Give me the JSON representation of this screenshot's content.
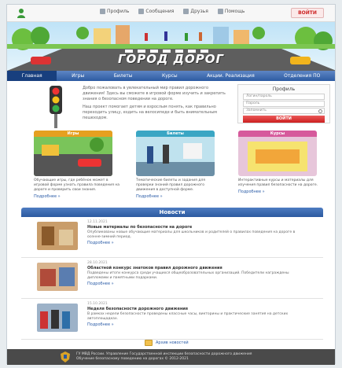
{
  "header": {
    "links": [
      {
        "label": "Профиль",
        "icon": "profile-icon"
      },
      {
        "label": "Сообщения",
        "icon": "messages-icon"
      },
      {
        "label": "Друзья",
        "icon": "friends-icon"
      },
      {
        "label": "Помощь",
        "icon": "help-icon"
      }
    ],
    "cta_label": "ВОЙТИ"
  },
  "banner": {
    "title": "ГОРОД ДОРОГ"
  },
  "nav": {
    "items": [
      {
        "label": "Главная"
      },
      {
        "label": "Игры"
      },
      {
        "label": "Билеты"
      },
      {
        "label": "Курсы"
      },
      {
        "label": "Акции. Реализация"
      },
      {
        "label": "Отделения ПО"
      }
    ]
  },
  "intro": {
    "paragraphs": [
      "Добро пожаловать в увлекательный мир правил дорожного движения! Здесь вы сможете в игровой форме изучить и закрепить знания о безопасном поведении на дороге.",
      "Наш проект помогает детям и взрослым понять, как правильно переходить улицу, ездить на велосипеде и быть внимательным пешеходом."
    ]
  },
  "login": {
    "title": "Профиль",
    "login_placeholder": "Логин/пароль",
    "pass_placeholder": "Пароль",
    "remember_label": "Запомнить",
    "submit_label": "ВОЙТИ"
  },
  "cards": [
    {
      "tab": "Игры",
      "text": "Обучающие игры, где ребёнок может в игровой форме узнать правила поведения на дороге и проверить свои знания.",
      "more": "Подробнее »",
      "color": "#e6a020"
    },
    {
      "tab": "Билеты",
      "text": "Тематические билеты и задания для проверки знаний правил дорожного движения в доступной форме.",
      "more": "Подробнее »",
      "color": "#3aa6c4"
    },
    {
      "tab": "Курсы",
      "text": "Интерактивные курсы и материалы для изучения правил безопасности на дороге.",
      "more": "Подробнее »",
      "color": "#d65a9c"
    }
  ],
  "news": {
    "header": "Новости",
    "items": [
      {
        "date": "12.11.2021",
        "title": "Новые материалы по безопасности на дороге",
        "text": "Опубликованы новые обучающие материалы для школьников и родителей о правилах поведения на дороге в осенне-зимний период.",
        "more": "Подробнее »"
      },
      {
        "date": "28.10.2021",
        "title": "Областной конкурс знатоков правил дорожного движения",
        "text": "Подведены итоги конкурса среди учащихся общеобразовательных организаций. Победители награждены дипломами и памятными подарками.",
        "more": "Подробнее »"
      },
      {
        "date": "15.10.2021",
        "title": "Неделя безопасности дорожного движения",
        "text": "В рамках недели безопасности проведены классные часы, викторины и практические занятия на детских автоплощадках.",
        "more": "Подробнее »"
      }
    ],
    "all_label": "Архив новостей"
  },
  "footer": {
    "line1": "ГУ МВД России. Управление Государственной инспекции безопасности дорожного движения",
    "line2": "Обучение безопасному поведению на дорогах © 2012-2021"
  }
}
